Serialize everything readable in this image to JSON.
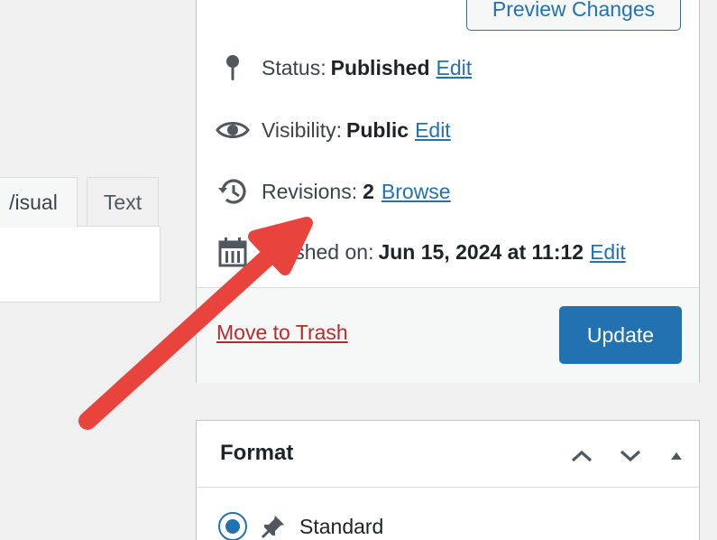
{
  "editor": {
    "tabs": [
      {
        "label": "Visual",
        "display": "/isual"
      },
      {
        "label": "Text"
      }
    ]
  },
  "publish": {
    "preview_button": "Preview Changes",
    "status": {
      "label": "Status:",
      "value": "Published",
      "action": "Edit",
      "icon": "pin-icon"
    },
    "visibility": {
      "label": "Visibility:",
      "value": "Public",
      "action": "Edit",
      "icon": "eye-icon"
    },
    "revisions": {
      "label": "Revisions:",
      "value": "2",
      "action": "Browse",
      "icon": "history-icon"
    },
    "published_on": {
      "label_visible": "lished on:",
      "label": "Published on:",
      "value": "Jun 15, 2024 at 11:12",
      "action": "Edit",
      "icon": "calendar-icon"
    },
    "trash_link": "Move to Trash",
    "update_button": "Update"
  },
  "format_box": {
    "title": "Format",
    "options": [
      {
        "label": "Standard",
        "selected": true,
        "icon": "pushpin-icon"
      }
    ]
  },
  "colors": {
    "accent": "#2271b1",
    "danger": "#b32d2e",
    "annotation_arrow": "#e8433d"
  }
}
